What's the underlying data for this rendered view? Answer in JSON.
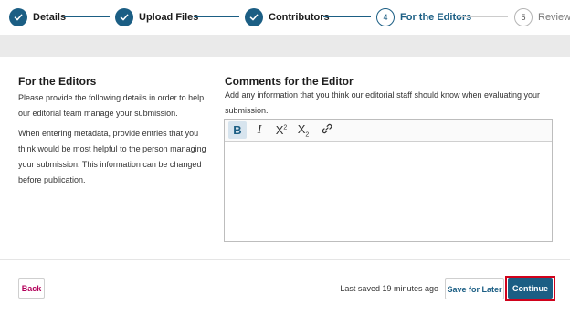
{
  "stepper": {
    "steps": [
      {
        "label": "Details",
        "state": "complete"
      },
      {
        "label": "Upload Files",
        "state": "complete"
      },
      {
        "label": "Contributors",
        "state": "complete"
      },
      {
        "number": "4",
        "label": "For the Editors",
        "state": "current"
      },
      {
        "number": "5",
        "label": "Review",
        "state": "upcoming"
      }
    ]
  },
  "left": {
    "title": "For the Editors",
    "paragraph1": "Please provide the following details in order to help our editorial team manage your submission.",
    "paragraph2": "When entering metadata, provide entries that you think would be most helpful to the person managing your submission. This information can be changed before publication."
  },
  "comments": {
    "title": "Comments for the Editor",
    "description": "Add any information that you think our editorial staff should know when evaluating your submission.",
    "value": ""
  },
  "toolbar": {
    "bold": "B",
    "italic": "I",
    "superscript_base": "X",
    "superscript_mark": "2",
    "subscript_base": "X",
    "subscript_mark": "2"
  },
  "footer": {
    "back": "Back",
    "last_saved": "Last saved 19 minutes ago",
    "save_for_later": "Save for Later",
    "continue": "Continue"
  },
  "colors": {
    "primary": "#1b5e84",
    "back_text": "#b3005a",
    "highlight": "#d0021b"
  },
  "icons": [
    "check-icon",
    "link-icon"
  ]
}
